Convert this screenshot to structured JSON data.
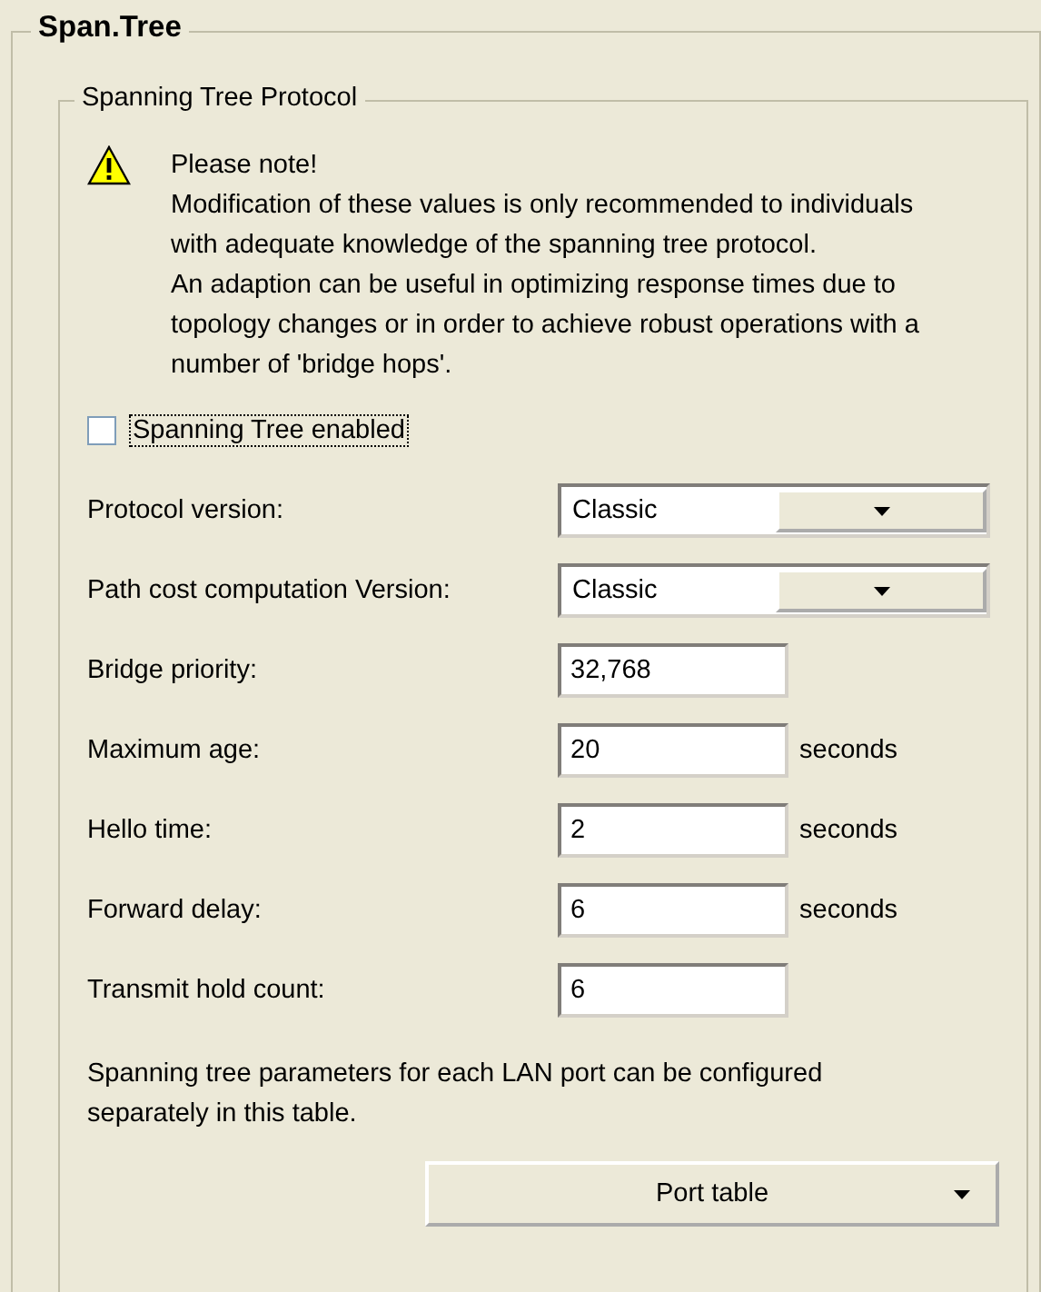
{
  "section": {
    "title": "Span.Tree"
  },
  "group": {
    "title": "Spanning Tree Protocol",
    "note": {
      "heading": "Please note!",
      "lines": [
        "Modification of these values is only recommended to individuals with adequate knowledge of the spanning tree protocol.",
        "An adaption can be useful in optimizing response times due to topology changes or in order to achieve robust operations with a number of 'bridge hops'."
      ]
    },
    "enable": {
      "label": "Spanning Tree enabled",
      "checked": false
    },
    "fields": [
      {
        "kind": "select",
        "label": "Protocol version:",
        "value": "Classic"
      },
      {
        "kind": "select",
        "label": "Path cost computation Version:",
        "value": "Classic"
      },
      {
        "kind": "input",
        "label": "Bridge priority:",
        "value": "32,768"
      },
      {
        "kind": "input",
        "label": "Maximum age:",
        "value": "20",
        "unit": "seconds"
      },
      {
        "kind": "input",
        "label": "Hello time:",
        "value": "2",
        "unit": "seconds"
      },
      {
        "kind": "input",
        "label": "Forward delay:",
        "value": "6",
        "unit": "seconds"
      },
      {
        "kind": "input",
        "label": "Transmit hold count:",
        "value": "6"
      }
    ],
    "footnote": "Spanning tree parameters for each LAN port can be configured separately in this table.",
    "button": {
      "label": "Port table"
    }
  }
}
